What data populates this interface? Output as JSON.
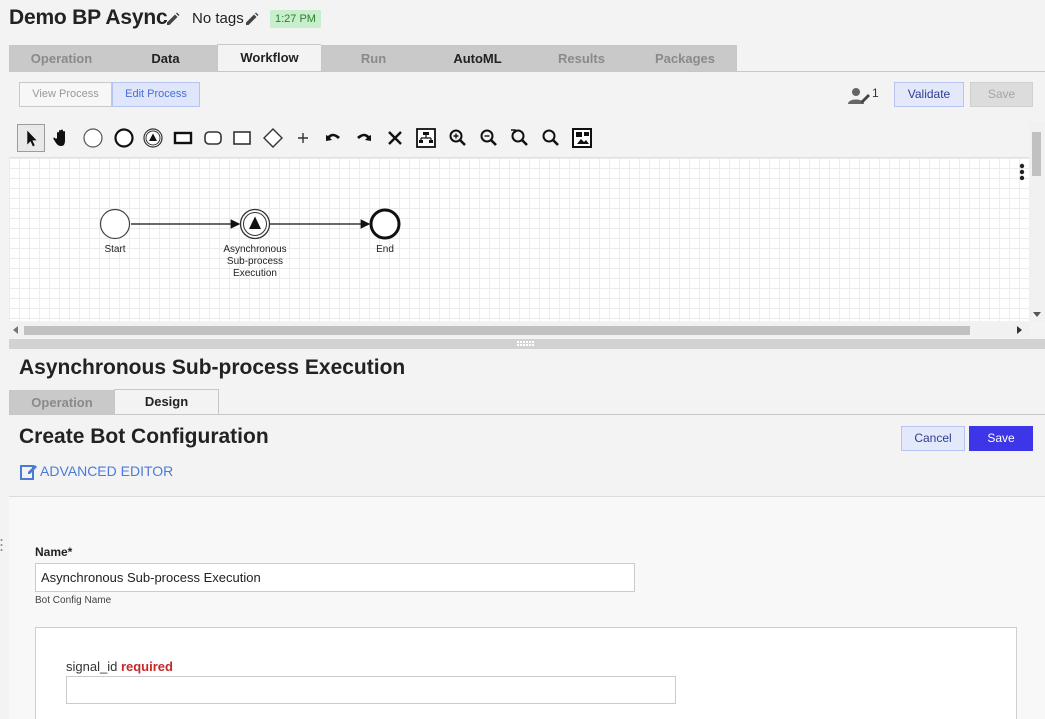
{
  "header": {
    "title": "Demo BP Async",
    "tags": "No tags",
    "time": "1:27 PM"
  },
  "main_tabs": [
    {
      "label": "Operation",
      "state": "disabled"
    },
    {
      "label": "Data",
      "state": "enabled"
    },
    {
      "label": "Workflow",
      "state": "active"
    },
    {
      "label": "Run",
      "state": "disabled"
    },
    {
      "label": "AutoML",
      "state": "enabled"
    },
    {
      "label": "Results",
      "state": "disabled"
    },
    {
      "label": "Packages",
      "state": "disabled"
    }
  ],
  "editor": {
    "view_process": "View Process",
    "edit_process": "Edit Process",
    "user_count": "1",
    "validate": "Validate",
    "save": "Save",
    "tools": [
      "pointer-icon",
      "hand-icon",
      "start-event-icon",
      "end-event-icon",
      "signal-event-icon",
      "task-icon",
      "subprocess-icon",
      "rectangle-icon",
      "gateway-icon",
      "add-icon",
      "undo-icon",
      "redo-icon",
      "delete-icon",
      "layout-icon",
      "zoom-in-icon",
      "zoom-out-icon",
      "zoom-reset-icon",
      "zoom-fit-icon",
      "outline-icon"
    ]
  },
  "diagram": {
    "start_label": "Start",
    "task_label_lines": [
      "Asynchronous",
      "Sub-process",
      "Execution"
    ],
    "end_label": "End"
  },
  "detail": {
    "title": "Asynchronous Sub-process Execution",
    "tabs": [
      {
        "label": "Operation",
        "state": "disabled"
      },
      {
        "label": "Design",
        "state": "active"
      }
    ],
    "config_title": "Create Bot Configuration",
    "cancel": "Cancel",
    "save": "Save",
    "advanced_editor": "ADVANCED EDITOR",
    "name_label": "Name*",
    "name_value": "Asynchronous Sub-process Execution",
    "name_hint": "Bot Config Name",
    "signal_label": "signal_id",
    "signal_required": "required",
    "signal_value": ""
  },
  "colors": {
    "accent": "#3d35e8",
    "required": "#c62828",
    "link": "#4b7bd8",
    "time_badge_bg": "#c8eecb"
  }
}
